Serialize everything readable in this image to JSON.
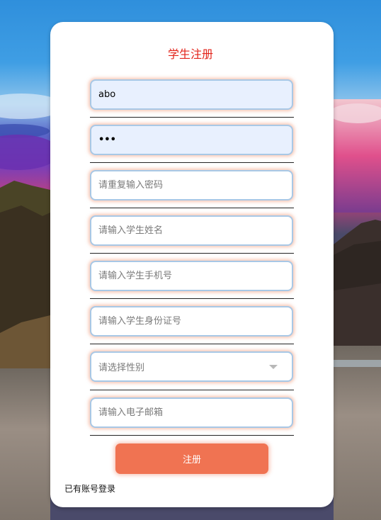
{
  "form": {
    "title": "学生注册",
    "username": {
      "value": "abo"
    },
    "password": {
      "value": "•••"
    },
    "confirm_password": {
      "placeholder": "请重复输入密码"
    },
    "student_name": {
      "placeholder": "请输入学生姓名"
    },
    "phone": {
      "placeholder": "请输入学生手机号"
    },
    "id_card": {
      "placeholder": "请输入学生身份证号"
    },
    "gender": {
      "placeholder": "请选择性别"
    },
    "email": {
      "placeholder": "请输入电子邮箱"
    },
    "submit_label": "注册",
    "login_link": "已有账号登录"
  },
  "colors": {
    "title": "#e2231a",
    "button": "#f07352",
    "field_border": "#a8c8e6",
    "autofill_bg": "#e8f0fe"
  },
  "icons": {
    "gender_dropdown": "caret-down-icon"
  }
}
